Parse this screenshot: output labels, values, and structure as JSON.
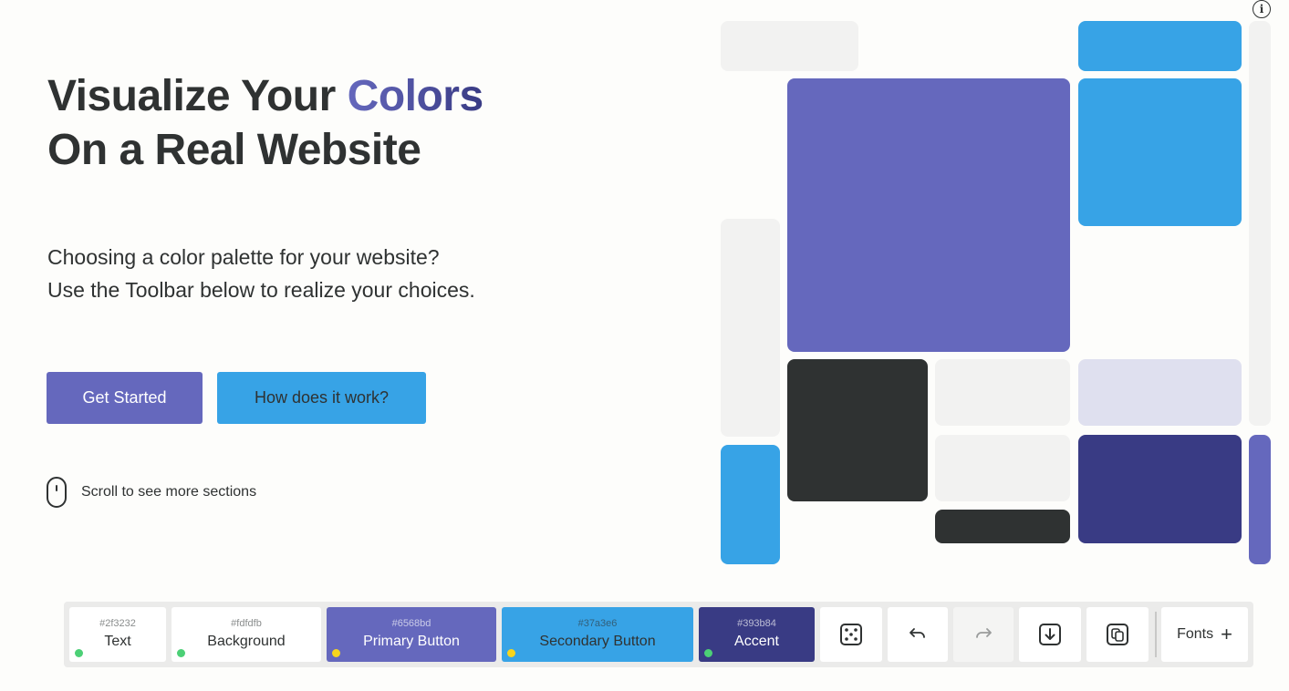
{
  "hero": {
    "title_line1_prefix": "Visualize Your",
    "title_line1_accent": "Colors",
    "title_line2": "On a Real Website",
    "subtitle_line1": "Choosing a color palette for your website?",
    "subtitle_line2": "Use the Toolbar below to realize your choices.",
    "primary_button": "Get Started",
    "secondary_button": "How does it work?",
    "scroll_hint": "Scroll to see more sections"
  },
  "info_icon": {
    "glyph": "i"
  },
  "palette": {
    "text": "#2f3232",
    "background": "#fdfdfb",
    "primary": "#6568bd",
    "secondary": "#37a3e6",
    "accent": "#393b84"
  },
  "toolbar": {
    "swatches": [
      {
        "hex": "#2f3232",
        "label": "Text",
        "status": "green"
      },
      {
        "hex": "#fdfdfb",
        "label": "Background",
        "status": "green"
      },
      {
        "hex": "#6568bd",
        "label": "Primary Button",
        "status": "yellow"
      },
      {
        "hex": "#37a3e6",
        "label": "Secondary Button",
        "status": "yellow"
      },
      {
        "hex": "#393b84",
        "label": "Accent",
        "status": "green"
      }
    ],
    "icons": {
      "randomize": "dice-icon",
      "undo": "undo-icon",
      "redo": "redo-icon",
      "export": "download-icon",
      "copy": "copy-icon"
    },
    "fonts_label": "Fonts",
    "fonts_icon": "+"
  }
}
